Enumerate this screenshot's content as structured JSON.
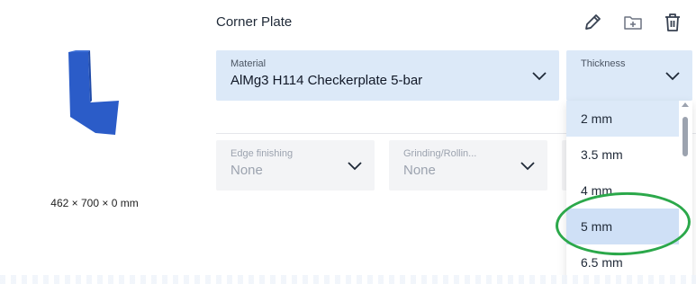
{
  "part": {
    "title": "Corner Plate",
    "dimensions": "462 × 700 × 0 mm",
    "preview_color": "#2b5cc8"
  },
  "toolbar": {
    "edit_icon": "pencil-icon",
    "add_folder_icon": "folder-plus-icon",
    "delete_icon": "trash-icon"
  },
  "material": {
    "label": "Material",
    "value": "AlMg3 H114 Checkerplate 5-bar"
  },
  "thickness": {
    "label": "Thickness",
    "value": "",
    "options": [
      "2 mm",
      "3.5 mm",
      "4 mm",
      "5 mm",
      "6.5 mm"
    ],
    "selected_index": 0,
    "hover_index": 3
  },
  "edge_finishing": {
    "label": "Edge finishing",
    "value": "None"
  },
  "grinding": {
    "label": "Grinding/Rollin...",
    "value": "None"
  },
  "colors": {
    "accent_bg": "#dce9f8",
    "highlight_ring": "#2ba84a"
  }
}
